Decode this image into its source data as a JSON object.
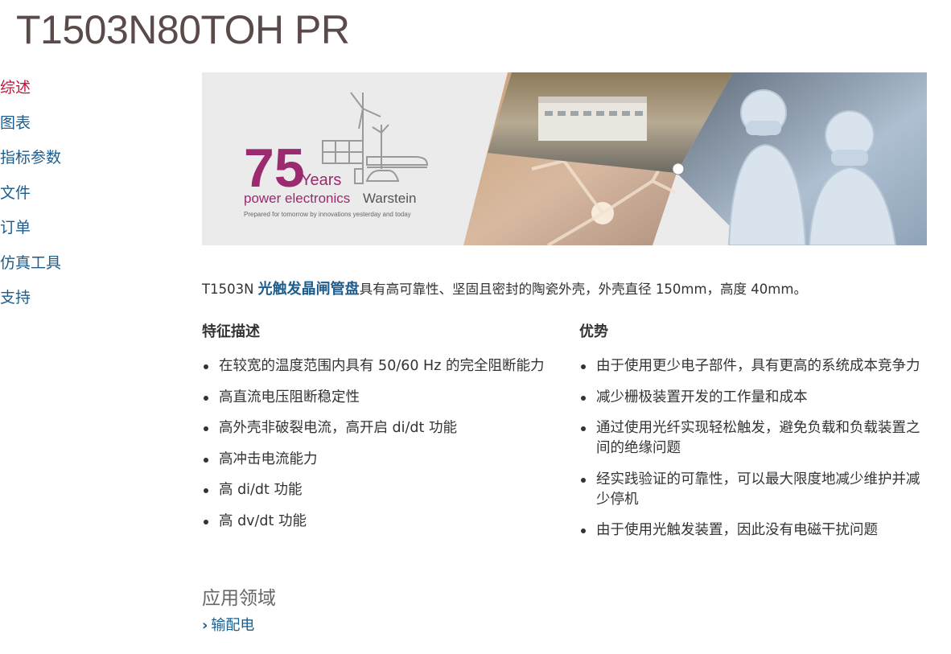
{
  "page": {
    "title": "T1503N80TOH PR"
  },
  "sidebar": {
    "items": [
      {
        "label": "综述",
        "active": true
      },
      {
        "label": "图表",
        "active": false
      },
      {
        "label": "指标参数",
        "active": false
      },
      {
        "label": "文件",
        "active": false
      },
      {
        "label": "订单",
        "active": false
      },
      {
        "label": "仿真工具",
        "active": false
      },
      {
        "label": "支持",
        "active": false
      }
    ]
  },
  "banner": {
    "number": "75",
    "years": "Years",
    "line1_a": "power electronics",
    "line1_b": "Warstein",
    "tagline": "Prepared for tomorrow by innovations yesterday and today"
  },
  "intro": {
    "prefix": "T1503N ",
    "link": "光触发晶闸管盘",
    "suffix": "具有高可靠性、坚固且密封的陶瓷外壳，外壳直径 150mm，高度 40mm。"
  },
  "features": {
    "title": "特征描述",
    "items": [
      "在较宽的温度范围内具有 50/60 Hz 的完全阻断能力",
      "高直流电压阻断稳定性",
      "高外壳非破裂电流，高开启 di/dt 功能",
      "高冲击电流能力",
      "高 di/dt 功能",
      "高 dv/dt 功能"
    ]
  },
  "advantages": {
    "title": "优势",
    "items": [
      "由于使用更少电子部件，具有更高的系统成本竞争力",
      "减少栅极装置开发的工作量和成本",
      "通过使用光纤实现轻松触发，避免负载和负载装置之间的绝缘问题",
      "经实践验证的可靠性，可以最大限度地减少维护并减少停机",
      "由于使用光触发装置，因此没有电磁干扰问题"
    ]
  },
  "applications": {
    "title": "应用领域",
    "link": "输配电"
  },
  "colors": {
    "link": "#1d5d8c",
    "active": "#c0143c",
    "brand": "#9b2a6e"
  }
}
